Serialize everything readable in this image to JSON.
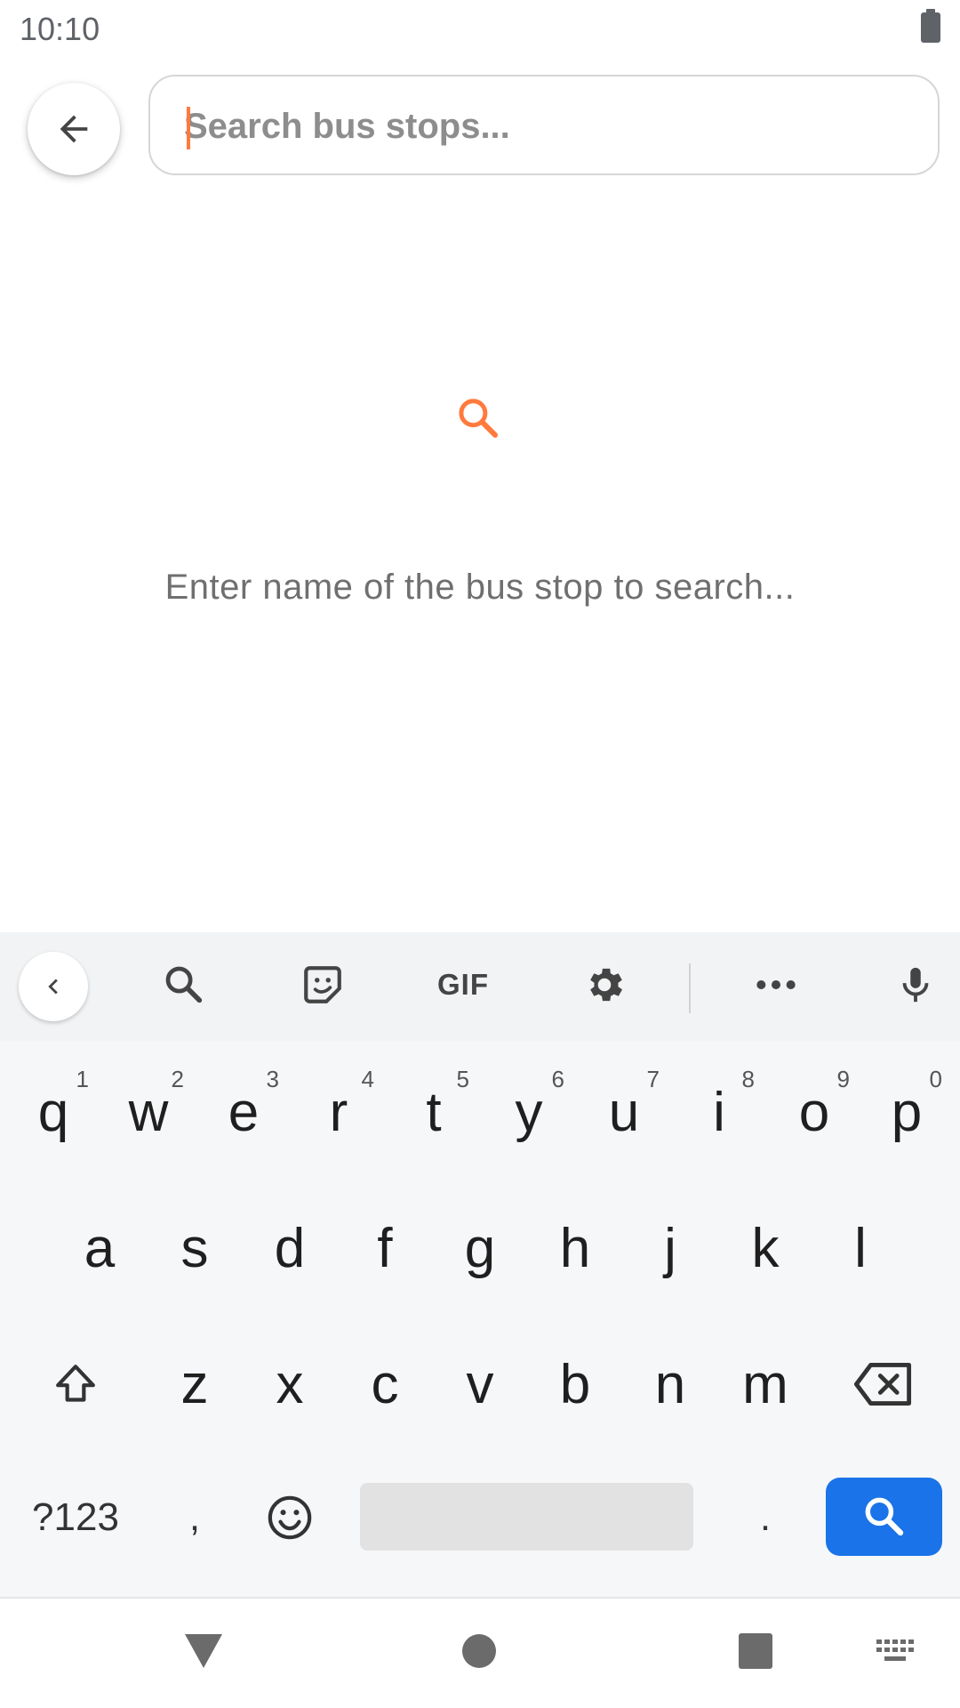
{
  "status_bar": {
    "time": "10:10"
  },
  "search": {
    "placeholder": "Search bus stops...",
    "value": ""
  },
  "empty_state": {
    "message": "Enter name of the bus stop to search..."
  },
  "colors": {
    "accent": "#ff7a3d",
    "keyboard_action": "#1a73e8"
  },
  "keyboard": {
    "toolbar": {
      "items": [
        "collapse-icon",
        "search-icon",
        "sticker-icon",
        "GIF",
        "gear-icon",
        "more-icon",
        "microphone-icon"
      ],
      "gif_label": "GIF"
    },
    "row1": [
      {
        "key": "q",
        "hint": "1"
      },
      {
        "key": "w",
        "hint": "2"
      },
      {
        "key": "e",
        "hint": "3"
      },
      {
        "key": "r",
        "hint": "4"
      },
      {
        "key": "t",
        "hint": "5"
      },
      {
        "key": "y",
        "hint": "6"
      },
      {
        "key": "u",
        "hint": "7"
      },
      {
        "key": "i",
        "hint": "8"
      },
      {
        "key": "o",
        "hint": "9"
      },
      {
        "key": "p",
        "hint": "0"
      }
    ],
    "row2": [
      "a",
      "s",
      "d",
      "f",
      "g",
      "h",
      "j",
      "k",
      "l"
    ],
    "row3": [
      "z",
      "x",
      "c",
      "v",
      "b",
      "n",
      "m"
    ],
    "row4": {
      "symbols": "?123",
      "comma": ",",
      "period": "."
    }
  },
  "nav_bar": {
    "items": [
      "back-icon",
      "home-icon",
      "recents-icon",
      "keyboard-icon"
    ]
  }
}
